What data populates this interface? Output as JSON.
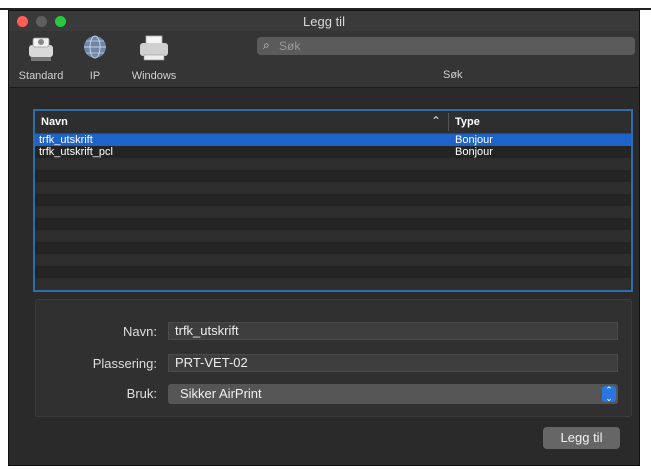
{
  "window": {
    "title": "Legg til"
  },
  "toolbar": {
    "tools": [
      {
        "label": "Standard",
        "icon": "printer-fax-icon"
      },
      {
        "label": "IP",
        "icon": "globe-icon"
      },
      {
        "label": "Windows",
        "icon": "printer-icon"
      }
    ],
    "search_placeholder": "Søk",
    "search_label": "Søk"
  },
  "list": {
    "columns": {
      "name": "Navn",
      "type": "Type"
    },
    "rows": [
      {
        "name": "trfk_utskrift",
        "type": "Bonjour",
        "selected": true
      },
      {
        "name": "trfk_utskrift_pcl",
        "type": "Bonjour",
        "selected": false
      }
    ]
  },
  "form": {
    "name_label": "Navn:",
    "name_value": "trfk_utskrift",
    "location_label": "Plassering:",
    "location_value": "PRT-VET-02",
    "use_label": "Bruk:",
    "use_value": "Sikker AirPrint"
  },
  "buttons": {
    "add": "Legg til"
  },
  "colors": {
    "selection": "#1e63c8",
    "focus_ring": "#2e6ea8",
    "window_bg": "#2a2a2a"
  }
}
